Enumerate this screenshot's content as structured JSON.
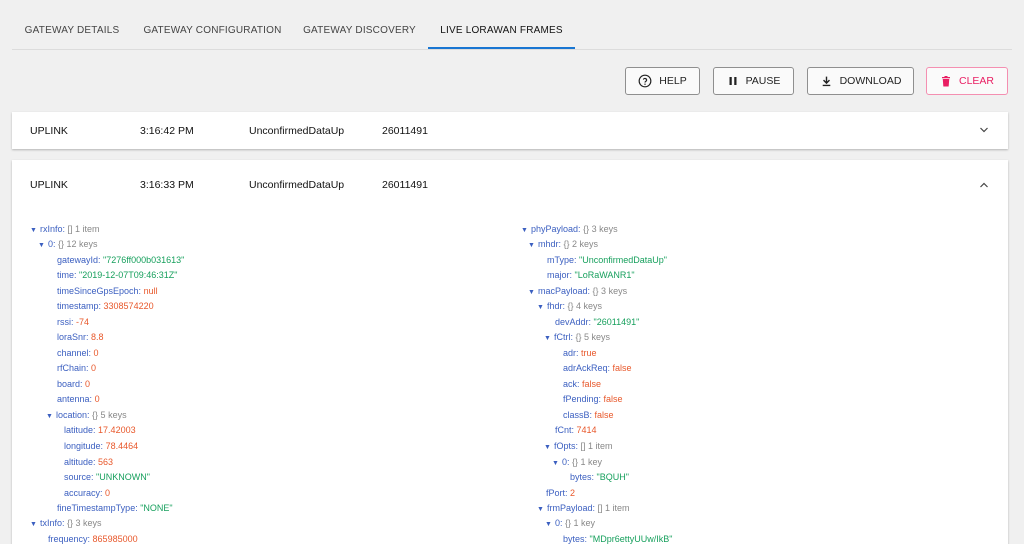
{
  "tabs": [
    {
      "label": "GATEWAY DETAILS"
    },
    {
      "label": "GATEWAY CONFIGURATION"
    },
    {
      "label": "GATEWAY DISCOVERY"
    },
    {
      "label": "LIVE LORAWAN FRAMES"
    }
  ],
  "toolbar": {
    "help": "HELP",
    "pause": "PAUSE",
    "download": "DOWNLOAD",
    "clear": "CLEAR"
  },
  "frames": [
    {
      "direction": "UPLINK",
      "time": "3:16:42 PM",
      "type": "UnconfirmedDataUp",
      "devaddr": "26011491"
    },
    {
      "direction": "UPLINK",
      "time": "3:16:33 PM",
      "type": "UnconfirmedDataUp",
      "devaddr": "26011491"
    }
  ],
  "tree": {
    "rxInfo_label": "rxInfo:",
    "rxInfo_meta": "[] 1 item",
    "item0_label": "0:",
    "item0_meta": "{} 12 keys",
    "gatewayId_k": "gatewayId:",
    "gatewayId_v": "\"7276ff000b031613\"",
    "time_k": "time:",
    "time_v": "\"2019-12-07T09:46:31Z\"",
    "tsgps_k": "timeSinceGpsEpoch:",
    "tsgps_v": "null",
    "timestamp_k": "timestamp:",
    "timestamp_v": "3308574220",
    "rssi_k": "rssi:",
    "rssi_v": "-74",
    "lorasnr_k": "loraSnr:",
    "lorasnr_v": "8.8",
    "channel_k": "channel:",
    "channel_v": "0",
    "rfchain_k": "rfChain:",
    "rfchain_v": "0",
    "board_k": "board:",
    "board_v": "0",
    "antenna_k": "antenna:",
    "antenna_v": "0",
    "location_k": "location:",
    "location_meta": "{} 5 keys",
    "lat_k": "latitude:",
    "lat_v": "17.42003",
    "lon_k": "longitude:",
    "lon_v": "78.4464",
    "alt_k": "altitude:",
    "alt_v": "563",
    "src_k": "source:",
    "src_v": "\"UNKNOWN\"",
    "acc_k": "accuracy:",
    "acc_v": "0",
    "fts_k": "fineTimestampType:",
    "fts_v": "\"NONE\"",
    "txinfo_k": "txInfo:",
    "txinfo_meta": "{} 3 keys",
    "freq_k": "frequency:",
    "freq_v": "865985000",
    "phy_k": "phyPayload:",
    "phy_meta": "{} 3 keys",
    "mhdr_k": "mhdr:",
    "mhdr_meta": "{} 2 keys",
    "mtype_k": "mType:",
    "mtype_v": "\"UnconfirmedDataUp\"",
    "major_k": "major:",
    "major_v": "\"LoRaWANR1\"",
    "macp_k": "macPayload:",
    "macp_meta": "{} 3 keys",
    "fhdr_k": "fhdr:",
    "fhdr_meta": "{} 4 keys",
    "devaddr_k": "devAddr:",
    "devaddr_v": "\"26011491\"",
    "fctrl_k": "fCtrl:",
    "fctrl_meta": "{} 5 keys",
    "adr_k": "adr:",
    "adr_v": "true",
    "adrack_k": "adrAckReq:",
    "adrack_v": "false",
    "ack_k": "ack:",
    "ack_v": "false",
    "fpend_k": "fPending:",
    "fpend_v": "false",
    "classb_k": "classB:",
    "classb_v": "false",
    "fcnt_k": "fCnt:",
    "fcnt_v": "7414",
    "fopts_k": "fOpts:",
    "fopts_meta": "[] 1 item",
    "fopts0_k": "0:",
    "fopts0_meta": "{} 1 key",
    "bytes1_k": "bytes:",
    "bytes1_v": "\"BQUH\"",
    "fport_k": "fPort:",
    "fport_v": "2",
    "frm_k": "frmPayload:",
    "frm_meta": "[] 1 item",
    "frm0_k": "0:",
    "frm0_meta": "{} 1 key",
    "bytes2_k": "bytes:",
    "bytes2_v": "\"MDpr6ettyUUw/IkB\""
  }
}
